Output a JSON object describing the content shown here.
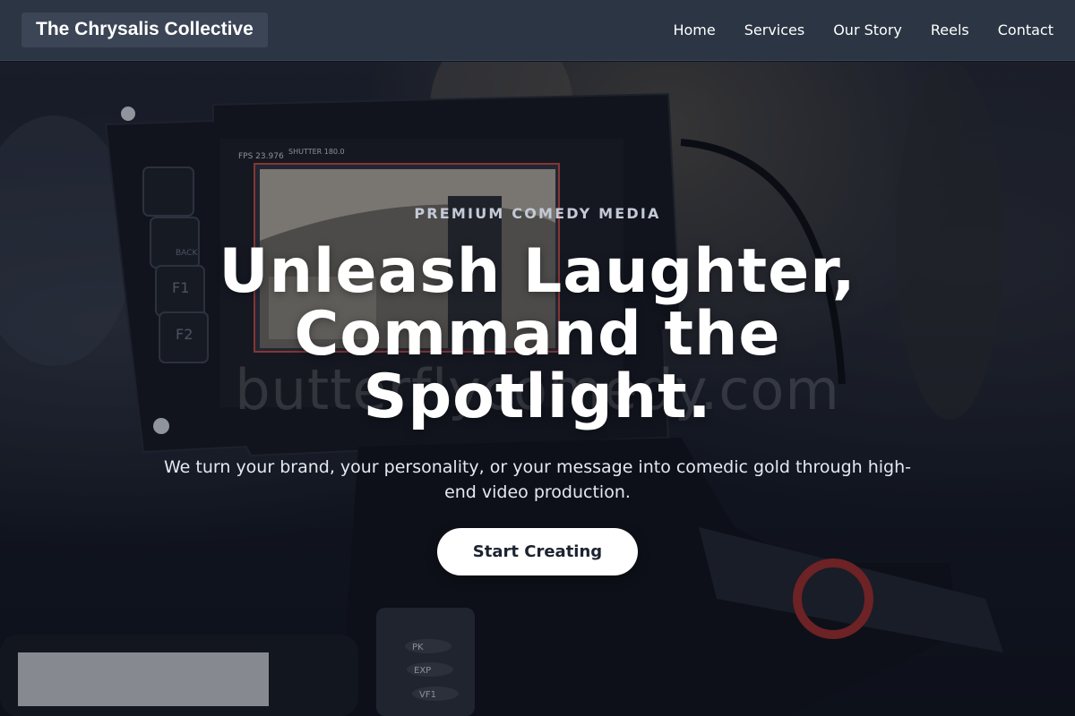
{
  "header": {
    "brand": "The Chrysalis Collective",
    "nav": [
      "Home",
      "Services",
      "Our Story",
      "Reels",
      "Contact"
    ]
  },
  "hero": {
    "eyebrow": "PREMIUM COMEDY MEDIA",
    "headline": "Unleash Laughter, Command the Spotlight.",
    "subtitle": "We turn your brand, your personality, or your message into comedic gold through high-end video production.",
    "cta_label": "Start Creating",
    "watermark": "butterflycomedy.com",
    "background_image": "camera-monitor-photo",
    "monitor_readout": {
      "fps": "FPS 23.976",
      "shutter": "SHUTTER 180.0",
      "buttons": [
        "BACK",
        "F1",
        "F2"
      ],
      "side_buttons": [
        "PK",
        "EXP",
        "VF1"
      ]
    }
  },
  "colors": {
    "header_bg": "#2c3544",
    "brand_bg": "#3b4556",
    "cta_bg": "#ffffff",
    "cta_text": "#1c2330",
    "eyebrow": "#c3cad6"
  }
}
